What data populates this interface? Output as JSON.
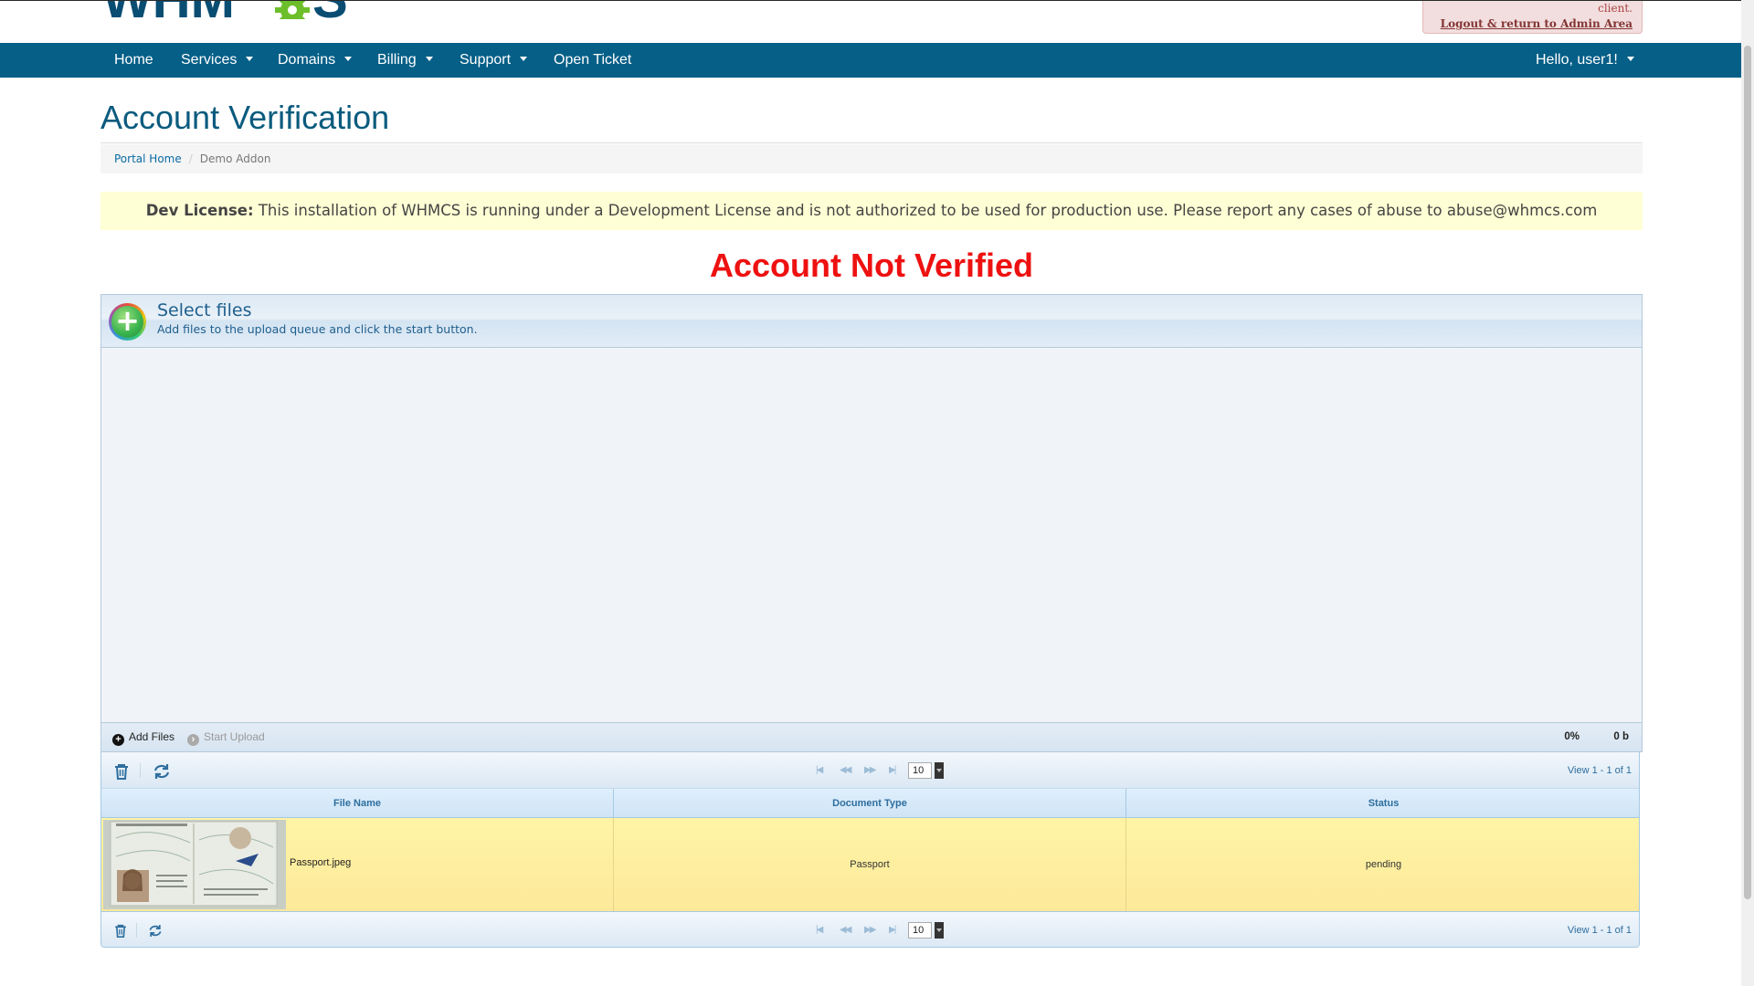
{
  "header": {
    "admin_notice": "client.",
    "admin_link": "Logout & return to Admin Area"
  },
  "nav": {
    "items": [
      "Home",
      "Services",
      "Domains",
      "Billing",
      "Support",
      "Open Ticket"
    ],
    "user_menu": "Hello, user1!"
  },
  "page": {
    "title": "Account Verification",
    "breadcrumb": [
      "Portal Home",
      "Demo Addon"
    ]
  },
  "alert": {
    "label": "Dev License:",
    "text": "This installation of WHMCS is running under a Development License and is not authorized to be used for production use. Please report any cases of abuse to abuse@whmcs.com"
  },
  "status_heading": "Account Not Verified",
  "uploader": {
    "title": "Select files",
    "subtitle": "Add files to the upload queue and click the start button.",
    "add_files": "Add Files",
    "start_upload": "Start Upload",
    "progress_percent": "0%",
    "size": "0 b"
  },
  "grid": {
    "page_size": "10",
    "view_text": "View 1 - 1 of 1",
    "columns": [
      "File Name",
      "Document Type",
      "Status"
    ],
    "rows": [
      {
        "file_name": "Passport.jpeg",
        "document_type": "Passport",
        "status": "pending"
      }
    ]
  },
  "colors": {
    "nav_bg": "#055f87",
    "title": "#0a5b7e",
    "status_red": "#ee1111",
    "alert_bg": "#ffffd5",
    "row_highlight": "#fff4a6"
  }
}
